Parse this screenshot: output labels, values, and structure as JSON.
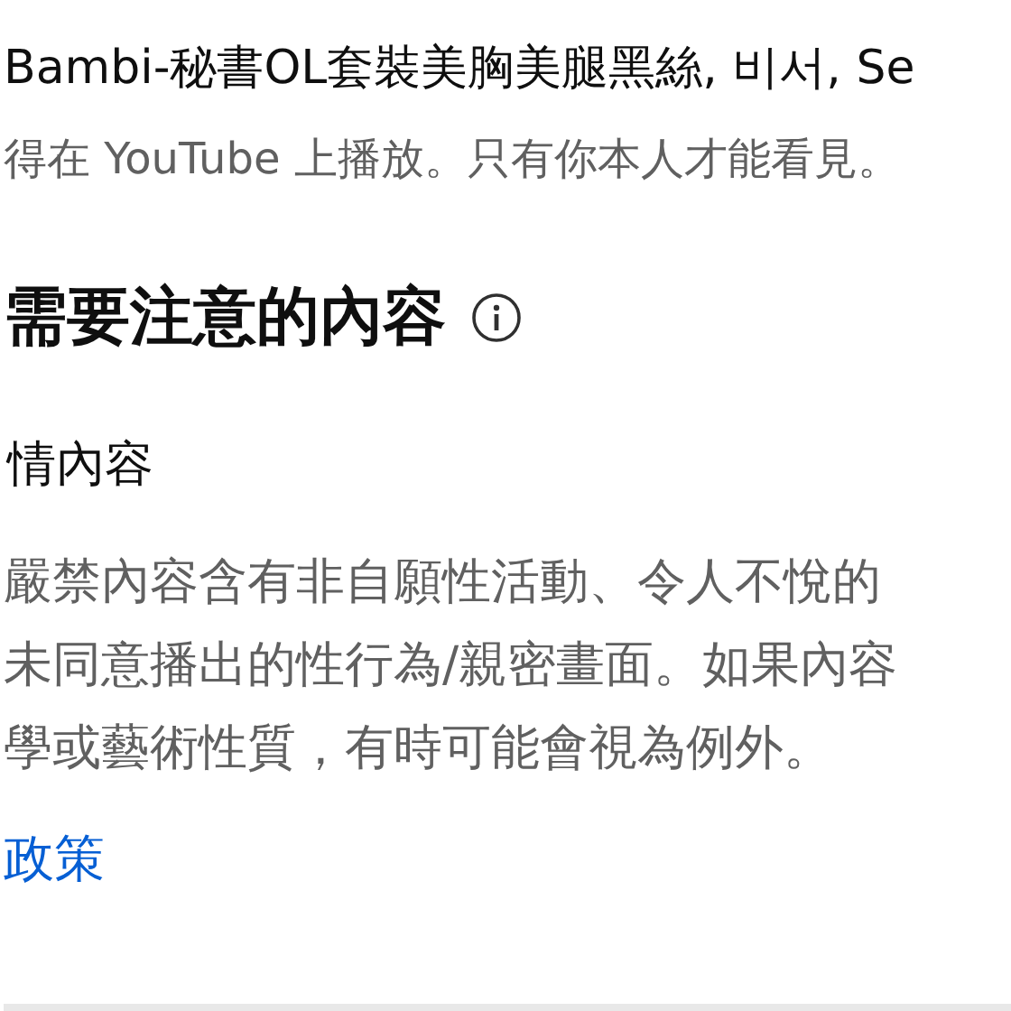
{
  "video_title": "Bambi-秘書OL套裝美胸美腿黑絲, 비서, Se",
  "visibility_note": "得在 YouTube 上播放。只有你本人才能看見。",
  "section": {
    "title": "需要注意的內容",
    "category": "情內容",
    "description_lines": [
      "嚴禁內容含有非自願性活動、令人不悅的",
      "未同意播出的性行為/親密畫面。如果內容",
      "學或藝術性質，有時可能會視為例外。"
    ],
    "link": "政策"
  }
}
